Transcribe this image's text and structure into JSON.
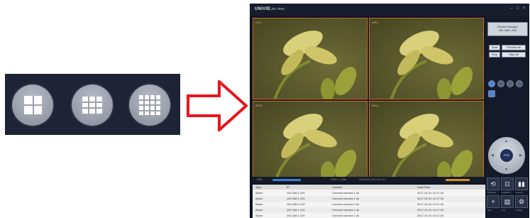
{
  "layout_selector": {
    "options": [
      {
        "name": "4 split",
        "cells": 4
      },
      {
        "name": "9 split",
        "cells": 9
      },
      {
        "name": "16 split",
        "cells": 16
      }
    ],
    "arrow_color": "#e8161c"
  },
  "app": {
    "logo": "UNIVIE",
    "title": "Live view",
    "window_controls": [
      "–",
      "□",
      "×"
    ],
    "cameras": [
      {
        "label": "CH 1"
      },
      {
        "label": "CH 2"
      },
      {
        "label": "CH 3"
      },
      {
        "label": "CH 4"
      }
    ],
    "status": {
      "left": "REC",
      "middle": "1920 × 1080",
      "right": "00:00:00   2017-01-01"
    },
    "log_headers": [
      "Type",
      "IP",
      "Content",
      "Date/Time"
    ],
    "log_rows": [
      [
        "Alarm",
        "192.168.1.100",
        "Connect camera 1 ok",
        "2017-01-01 14:17:20"
      ],
      [
        "Alarm",
        "192.168.1.100",
        "Connect camera 2 ok",
        "2017-01-01 14:17:20"
      ],
      [
        "Alarm",
        "192.168.1.100",
        "Connect camera 3 ok",
        "2017-01-01 14:17:20"
      ],
      [
        "Alarm",
        "192.168.1.100",
        "Connect camera 4 ok",
        "2017-01-01 14:17:20"
      ],
      [
        "Alarm",
        "192.168.1.100",
        "Connect camera 1 ok",
        "2017-01-01 14:17:20"
      ]
    ],
    "panel": {
      "device_box": [
        "Device Manager",
        "192.168.1.100"
      ],
      "buttons": [
        "Start",
        "Preview All",
        "Stop",
        "Stop All"
      ],
      "ptz_center": "PTZ",
      "tools": [
        {
          "icon": "⟲",
          "label": "Playback"
        },
        {
          "icon": "⊡",
          "label": "Snapshot"
        },
        {
          "icon": "▮▮",
          "label": "Record"
        },
        {
          "icon": "+",
          "label": "Add"
        },
        {
          "icon": "▤",
          "label": "Log"
        },
        {
          "icon": "⚙",
          "label": "Config"
        }
      ]
    }
  }
}
